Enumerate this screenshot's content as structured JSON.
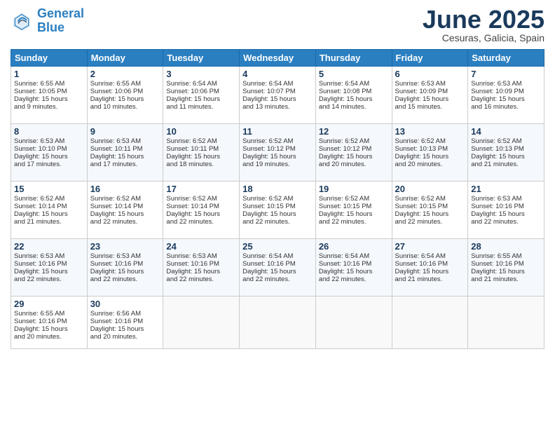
{
  "logo": {
    "line1": "General",
    "line2": "Blue"
  },
  "title": "June 2025",
  "subtitle": "Cesuras, Galicia, Spain",
  "days_header": [
    "Sunday",
    "Monday",
    "Tuesday",
    "Wednesday",
    "Thursday",
    "Friday",
    "Saturday"
  ],
  "weeks": [
    [
      {
        "day": "1",
        "lines": [
          "Sunrise: 6:55 AM",
          "Sunset: 10:05 PM",
          "Daylight: 15 hours",
          "and 9 minutes."
        ]
      },
      {
        "day": "2",
        "lines": [
          "Sunrise: 6:55 AM",
          "Sunset: 10:06 PM",
          "Daylight: 15 hours",
          "and 10 minutes."
        ]
      },
      {
        "day": "3",
        "lines": [
          "Sunrise: 6:54 AM",
          "Sunset: 10:06 PM",
          "Daylight: 15 hours",
          "and 11 minutes."
        ]
      },
      {
        "day": "4",
        "lines": [
          "Sunrise: 6:54 AM",
          "Sunset: 10:07 PM",
          "Daylight: 15 hours",
          "and 13 minutes."
        ]
      },
      {
        "day": "5",
        "lines": [
          "Sunrise: 6:54 AM",
          "Sunset: 10:08 PM",
          "Daylight: 15 hours",
          "and 14 minutes."
        ]
      },
      {
        "day": "6",
        "lines": [
          "Sunrise: 6:53 AM",
          "Sunset: 10:09 PM",
          "Daylight: 15 hours",
          "and 15 minutes."
        ]
      },
      {
        "day": "7",
        "lines": [
          "Sunrise: 6:53 AM",
          "Sunset: 10:09 PM",
          "Daylight: 15 hours",
          "and 16 minutes."
        ]
      }
    ],
    [
      {
        "day": "8",
        "lines": [
          "Sunrise: 6:53 AM",
          "Sunset: 10:10 PM",
          "Daylight: 15 hours",
          "and 17 minutes."
        ]
      },
      {
        "day": "9",
        "lines": [
          "Sunrise: 6:53 AM",
          "Sunset: 10:11 PM",
          "Daylight: 15 hours",
          "and 17 minutes."
        ]
      },
      {
        "day": "10",
        "lines": [
          "Sunrise: 6:52 AM",
          "Sunset: 10:11 PM",
          "Daylight: 15 hours",
          "and 18 minutes."
        ]
      },
      {
        "day": "11",
        "lines": [
          "Sunrise: 6:52 AM",
          "Sunset: 10:12 PM",
          "Daylight: 15 hours",
          "and 19 minutes."
        ]
      },
      {
        "day": "12",
        "lines": [
          "Sunrise: 6:52 AM",
          "Sunset: 10:12 PM",
          "Daylight: 15 hours",
          "and 20 minutes."
        ]
      },
      {
        "day": "13",
        "lines": [
          "Sunrise: 6:52 AM",
          "Sunset: 10:13 PM",
          "Daylight: 15 hours",
          "and 20 minutes."
        ]
      },
      {
        "day": "14",
        "lines": [
          "Sunrise: 6:52 AM",
          "Sunset: 10:13 PM",
          "Daylight: 15 hours",
          "and 21 minutes."
        ]
      }
    ],
    [
      {
        "day": "15",
        "lines": [
          "Sunrise: 6:52 AM",
          "Sunset: 10:14 PM",
          "Daylight: 15 hours",
          "and 21 minutes."
        ]
      },
      {
        "day": "16",
        "lines": [
          "Sunrise: 6:52 AM",
          "Sunset: 10:14 PM",
          "Daylight: 15 hours",
          "and 22 minutes."
        ]
      },
      {
        "day": "17",
        "lines": [
          "Sunrise: 6:52 AM",
          "Sunset: 10:14 PM",
          "Daylight: 15 hours",
          "and 22 minutes."
        ]
      },
      {
        "day": "18",
        "lines": [
          "Sunrise: 6:52 AM",
          "Sunset: 10:15 PM",
          "Daylight: 15 hours",
          "and 22 minutes."
        ]
      },
      {
        "day": "19",
        "lines": [
          "Sunrise: 6:52 AM",
          "Sunset: 10:15 PM",
          "Daylight: 15 hours",
          "and 22 minutes."
        ]
      },
      {
        "day": "20",
        "lines": [
          "Sunrise: 6:52 AM",
          "Sunset: 10:15 PM",
          "Daylight: 15 hours",
          "and 22 minutes."
        ]
      },
      {
        "day": "21",
        "lines": [
          "Sunrise: 6:53 AM",
          "Sunset: 10:16 PM",
          "Daylight: 15 hours",
          "and 22 minutes."
        ]
      }
    ],
    [
      {
        "day": "22",
        "lines": [
          "Sunrise: 6:53 AM",
          "Sunset: 10:16 PM",
          "Daylight: 15 hours",
          "and 22 minutes."
        ]
      },
      {
        "day": "23",
        "lines": [
          "Sunrise: 6:53 AM",
          "Sunset: 10:16 PM",
          "Daylight: 15 hours",
          "and 22 minutes."
        ]
      },
      {
        "day": "24",
        "lines": [
          "Sunrise: 6:53 AM",
          "Sunset: 10:16 PM",
          "Daylight: 15 hours",
          "and 22 minutes."
        ]
      },
      {
        "day": "25",
        "lines": [
          "Sunrise: 6:54 AM",
          "Sunset: 10:16 PM",
          "Daylight: 15 hours",
          "and 22 minutes."
        ]
      },
      {
        "day": "26",
        "lines": [
          "Sunrise: 6:54 AM",
          "Sunset: 10:16 PM",
          "Daylight: 15 hours",
          "and 22 minutes."
        ]
      },
      {
        "day": "27",
        "lines": [
          "Sunrise: 6:54 AM",
          "Sunset: 10:16 PM",
          "Daylight: 15 hours",
          "and 21 minutes."
        ]
      },
      {
        "day": "28",
        "lines": [
          "Sunrise: 6:55 AM",
          "Sunset: 10:16 PM",
          "Daylight: 15 hours",
          "and 21 minutes."
        ]
      }
    ],
    [
      {
        "day": "29",
        "lines": [
          "Sunrise: 6:55 AM",
          "Sunset: 10:16 PM",
          "Daylight: 15 hours",
          "and 20 minutes."
        ]
      },
      {
        "day": "30",
        "lines": [
          "Sunrise: 6:56 AM",
          "Sunset: 10:16 PM",
          "Daylight: 15 hours",
          "and 20 minutes."
        ]
      },
      {
        "day": "",
        "lines": []
      },
      {
        "day": "",
        "lines": []
      },
      {
        "day": "",
        "lines": []
      },
      {
        "day": "",
        "lines": []
      },
      {
        "day": "",
        "lines": []
      }
    ]
  ]
}
